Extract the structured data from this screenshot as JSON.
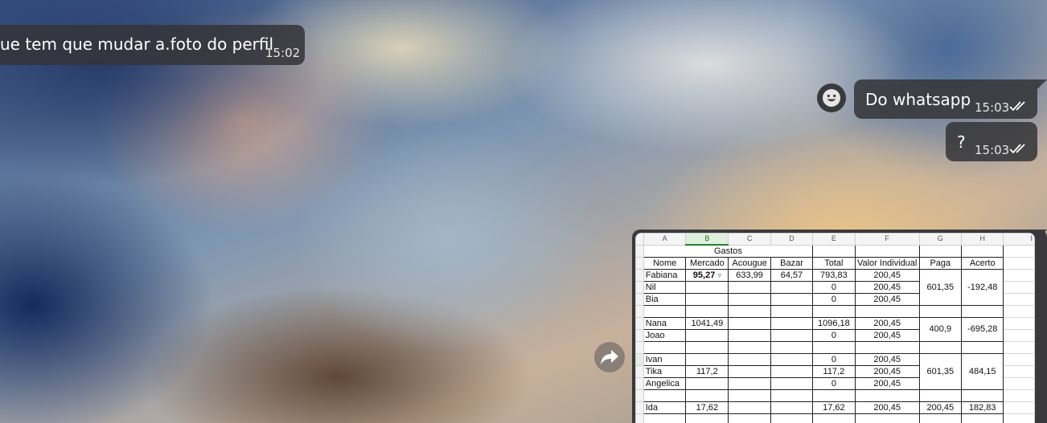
{
  "messages": [
    {
      "id": "incoming",
      "text": "ue tem que mudar a.foto do perfil",
      "time": "15:02"
    },
    {
      "id": "out1",
      "text": "Do whatsapp",
      "time": "15:03"
    },
    {
      "id": "out2",
      "text": "?",
      "time": "15:03"
    }
  ],
  "icons": {
    "avatar": "smiley-face-icon",
    "forward": "forward-arrow-icon",
    "read": "double-check-icon"
  },
  "colors": {
    "bubble": "#343438",
    "filter_green": "#2e7d32"
  },
  "sheet": {
    "columns": [
      "A",
      "B",
      "C",
      "D",
      "E",
      "F",
      "G",
      "H",
      "I"
    ],
    "title": "Gastos",
    "headers": [
      "Nome",
      "Mercado",
      "Acougue",
      "Bazar",
      "Total",
      "Valor Individual",
      "Paga",
      "Acerto"
    ],
    "rows": {
      "r1": {
        "name": "Fabiana",
        "mercado": "95,27",
        "acougue": "633,99",
        "bazar": "64,57",
        "total": "793,83",
        "valor": "200,45"
      },
      "r2": {
        "name": "Nil",
        "total": "0",
        "valor": "200,45"
      },
      "r3": {
        "name": "Bia",
        "total": "0",
        "valor": "200,45"
      },
      "g1": {
        "paga": "601,35",
        "acerto": "-192,48"
      },
      "r4": {
        "name": "Nana",
        "mercado": "1041,49",
        "total": "1096,18",
        "valor": "200,45"
      },
      "r5": {
        "name": "Joao",
        "total": "0",
        "valor": "200,45"
      },
      "g2": {
        "paga": "400,9",
        "acerto": "-695,28"
      },
      "r6": {
        "name": "Ivan",
        "total": "0",
        "valor": "200,45"
      },
      "r7": {
        "name": "Tika",
        "mercado": "117,2",
        "total": "117,2",
        "valor": "200,45"
      },
      "r8": {
        "name": "Angelica",
        "total": "0",
        "valor": "200,45"
      },
      "g3": {
        "paga": "601,35",
        "acerto": "484,15"
      },
      "r9": {
        "name": "Ida",
        "mercado": "17,62",
        "total": "17,62",
        "valor": "200,45",
        "paga": "200,45",
        "acerto": "182,83"
      }
    }
  }
}
